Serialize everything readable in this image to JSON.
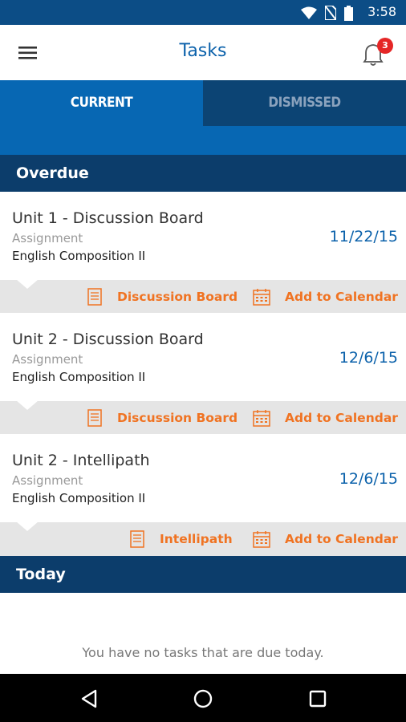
{
  "status_bar": {
    "time": "3:58",
    "icons": [
      "wifi-icon",
      "no-sim-icon",
      "battery-icon"
    ]
  },
  "app_bar": {
    "title": "Tasks",
    "notification_count": "3"
  },
  "tabs": [
    {
      "label": "CURRENT",
      "active": true
    },
    {
      "label": "DISMISSED",
      "active": false
    }
  ],
  "sections": {
    "overdue": {
      "title": "Overdue",
      "tasks": [
        {
          "name": "Unit 1 - Discussion Board",
          "type": "Assignment",
          "course": "English Composition II",
          "date": "11/22/15",
          "action_label": "Discussion Board",
          "calendar_label": "Add to Calendar"
        },
        {
          "name": "Unit 2 - Discussion Board",
          "type": "Assignment",
          "course": "English Composition II",
          "date": "12/6/15",
          "action_label": "Discussion Board",
          "calendar_label": "Add to Calendar"
        },
        {
          "name": "Unit 2 - Intellipath",
          "type": "Assignment",
          "course": "English Composition II",
          "date": "12/6/15",
          "action_label": "Intellipath",
          "calendar_label": "Add to Calendar"
        }
      ]
    },
    "today": {
      "title": "Today",
      "empty_message": "You have no tasks that are due today."
    }
  },
  "colors": {
    "primary": "#0767b3",
    "dark_blue": "#0c3d6b",
    "accent_orange": "#f07322",
    "badge_red": "#e52626"
  }
}
